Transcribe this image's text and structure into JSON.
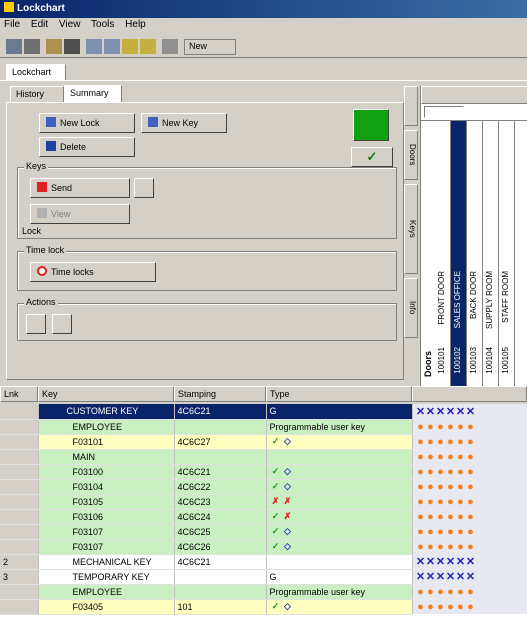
{
  "window": {
    "title": "Lockchart"
  },
  "menu": [
    "File",
    "Edit",
    "View",
    "Tools",
    "Help"
  ],
  "toolbar": {
    "text_button": "New"
  },
  "tabs": {
    "outer": "Lockchart",
    "history": "History",
    "summary": "Summary"
  },
  "summary": {
    "btn_new_lock": "New Lock",
    "btn_new_key": "New Key",
    "btn_delete": "Delete",
    "keys_group": "Keys",
    "btn_send": "Send",
    "btn_view": "View",
    "lock_label": "Lock",
    "timelock_group": "Time lock",
    "btn_timelock": "Time locks",
    "actions_group": "Actions"
  },
  "right_tabs": [
    "Doors",
    "Keys",
    "Info"
  ],
  "grid": {
    "headers": [
      "Lnk",
      "Key",
      "Stamping",
      "Type"
    ],
    "rows": [
      {
        "lnk": "",
        "key": "CUSTOMER KEY",
        "stamp": "4C6C21",
        "type": "G",
        "style": "selected",
        "marks": "xxxxxx"
      },
      {
        "lnk": "",
        "key": "EMPLOYEE",
        "stamp": "",
        "type": "Programmable user key",
        "style": "green",
        "marks": "oooooo"
      },
      {
        "lnk": "",
        "key": "F03101",
        "stamp": "4C6C27",
        "type": "✓◇",
        "style": "yellow",
        "marks": "oooooo"
      },
      {
        "lnk": "",
        "key": "MAIN",
        "stamp": "",
        "type": "",
        "style": "green",
        "marks": "oooooo"
      },
      {
        "lnk": "",
        "key": "F03100",
        "stamp": "4C6C21",
        "type": "✓◇",
        "style": "green",
        "marks": "oooooo"
      },
      {
        "lnk": "",
        "key": "F03104",
        "stamp": "4C6C22",
        "type": "✓◇",
        "style": "green",
        "marks": "oooooo"
      },
      {
        "lnk": "",
        "key": "F03105",
        "stamp": "4C6C23",
        "type": "✗✗",
        "style": "green",
        "marks": "oooooo"
      },
      {
        "lnk": "",
        "key": "F03106",
        "stamp": "4C6C24",
        "type": "✓✗",
        "style": "green",
        "marks": "oooooo"
      },
      {
        "lnk": "",
        "key": "F03107",
        "stamp": "4C6C25",
        "type": "✓◇",
        "style": "green",
        "marks": "oooooo"
      },
      {
        "lnk": "",
        "key": "F03107",
        "stamp": "4C6C26",
        "type": "✓◇",
        "style": "green",
        "marks": "oooooo"
      },
      {
        "lnk": "2",
        "key": "MECHANICAL KEY",
        "stamp": "4C6C21",
        "type": "",
        "style": "white",
        "marks": "xxxxxx"
      },
      {
        "lnk": "3",
        "key": "TEMPORARY KEY",
        "stamp": "",
        "type": "G",
        "style": "white",
        "marks": "xxxxxx"
      },
      {
        "lnk": "",
        "key": "EMPLOYEE",
        "stamp": "",
        "type": "Programmable user key",
        "style": "green",
        "marks": "oooooo"
      },
      {
        "lnk": "",
        "key": "F03405",
        "stamp": "101",
        "type": "✓◇",
        "style": "yellow",
        "marks": "oooooo"
      }
    ]
  },
  "matrix": {
    "doors_label": "Doors",
    "columns": [
      {
        "name": "FRONT DOOR",
        "id": "100101"
      },
      {
        "name": "SALES OFFICE",
        "id": "100102"
      },
      {
        "name": "BACK DOOR",
        "id": "100103"
      },
      {
        "name": "SUPPLY ROOM",
        "id": "100104"
      },
      {
        "name": "STAFF ROOM",
        "id": "100105"
      }
    ]
  },
  "colors": {
    "selected": "#0a246a",
    "green": "#c8f0c0",
    "yellow": "#ffffc0",
    "orange": "#f08020",
    "blue": "#2020c0"
  }
}
